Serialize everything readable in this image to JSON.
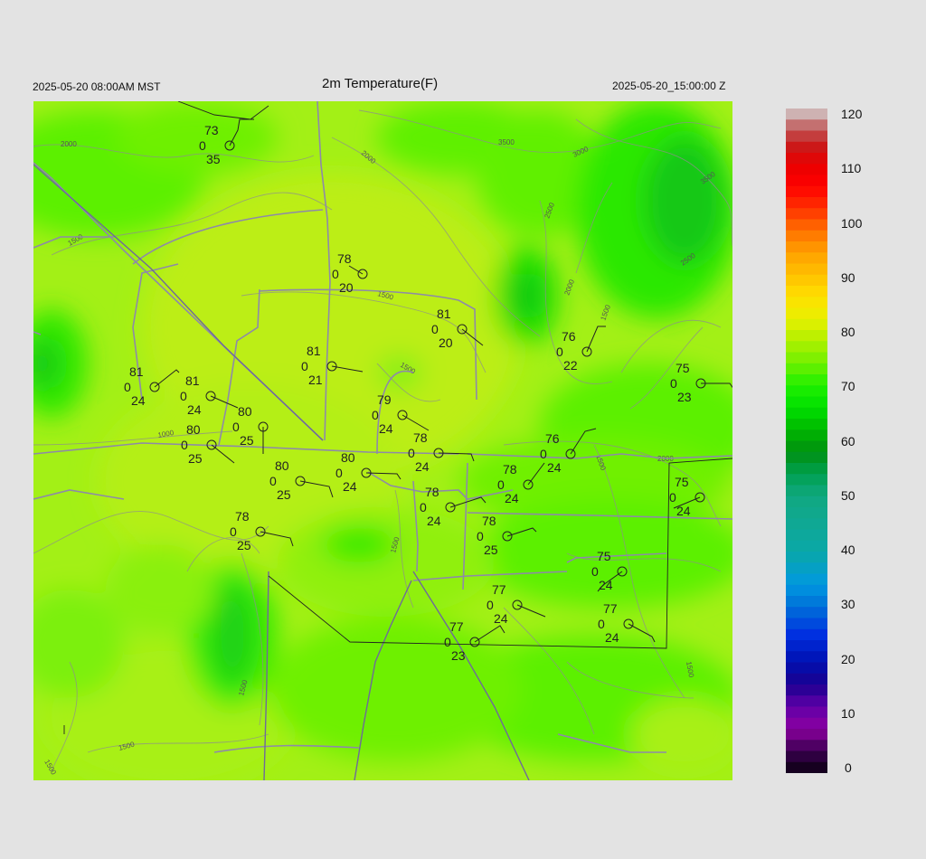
{
  "header": {
    "local_time": "2025-05-20 08:00AM MST",
    "title": "2m Temperature(F)",
    "utc_time": "2025-05-20_15:00:00 Z"
  },
  "colorbar": {
    "labels": [
      "120",
      "110",
      "100",
      "90",
      "80",
      "70",
      "60",
      "50",
      "40",
      "30",
      "20",
      "10",
      "0"
    ],
    "range": [
      0,
      120
    ],
    "colors": {
      "background": "#e3e3e3",
      "dominant_field": "#aef21a",
      "cooler_field": "#44f000",
      "coolest_field": "#20c81e"
    }
  },
  "contour_labels": [
    "2000",
    "2000",
    "1500",
    "1500",
    "1500",
    "1000",
    "3500",
    "3000",
    "2500",
    "2000",
    "1500",
    "3500",
    "2500",
    "2000",
    "1500",
    "1500",
    "1500",
    "1500",
    "1500",
    "1500"
  ],
  "stations": [
    {
      "temp": "73",
      "zero": "0",
      "dew": "35"
    },
    {
      "temp": "78",
      "zero": "0",
      "dew": "20"
    },
    {
      "temp": "81",
      "zero": "0",
      "dew": "20"
    },
    {
      "temp": "76",
      "zero": "0",
      "dew": "22"
    },
    {
      "temp": "81",
      "zero": "0",
      "dew": "24"
    },
    {
      "temp": "81",
      "zero": "0",
      "dew": "24"
    },
    {
      "temp": "81",
      "zero": "0",
      "dew": "21"
    },
    {
      "temp": "75",
      "zero": "0",
      "dew": "23"
    },
    {
      "temp": "80",
      "zero": "0",
      "dew": "25"
    },
    {
      "temp": "79",
      "zero": "0",
      "dew": "24"
    },
    {
      "temp": "80",
      "zero": "0",
      "dew": "25"
    },
    {
      "temp": "78",
      "zero": "0",
      "dew": "24"
    },
    {
      "temp": "76",
      "zero": "0",
      "dew": "24"
    },
    {
      "temp": "80",
      "zero": "0",
      "dew": "24"
    },
    {
      "temp": "80",
      "zero": "0",
      "dew": "25"
    },
    {
      "temp": "78",
      "zero": "0",
      "dew": "24"
    },
    {
      "temp": "75",
      "zero": "0",
      "dew": "24"
    },
    {
      "temp": "78",
      "zero": "0",
      "dew": "24"
    },
    {
      "temp": "78",
      "zero": "0",
      "dew": "25"
    },
    {
      "temp": "78",
      "zero": "0",
      "dew": "25"
    },
    {
      "temp": "75",
      "zero": "0",
      "dew": "24"
    },
    {
      "temp": "77",
      "zero": "0",
      "dew": "24"
    },
    {
      "temp": "77",
      "zero": "0",
      "dew": "24"
    },
    {
      "temp": "77",
      "zero": "0",
      "dew": "23"
    }
  ]
}
